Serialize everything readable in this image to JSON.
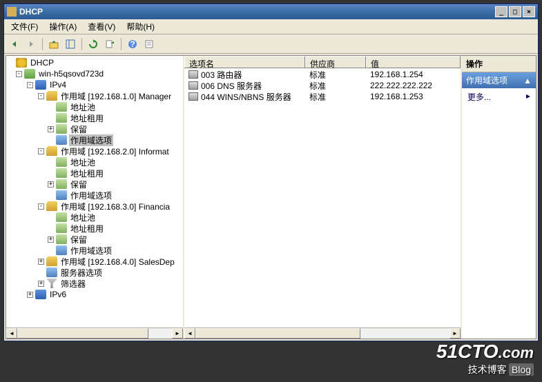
{
  "window": {
    "title": "DHCP"
  },
  "titlebar_buttons": {
    "min": "_",
    "max": "□",
    "close": "×"
  },
  "menu": {
    "file": "文件(F)",
    "action": "操作(A)",
    "view": "查看(V)",
    "help": "帮助(H)"
  },
  "tree": {
    "root": "DHCP",
    "server": "win-h5qsovd723d",
    "ipv4": "IPv4",
    "ipv6": "IPv6",
    "scope1": {
      "label": "作用域 [192.168.1.0] Manager",
      "pool": "地址池",
      "lease": "地址租用",
      "reserve": "保留",
      "options": "作用域选项"
    },
    "scope2": {
      "label": "作用域 [192.168.2.0] Informat",
      "pool": "地址池",
      "lease": "地址租用",
      "reserve": "保留",
      "options": "作用域选项"
    },
    "scope3": {
      "label": "作用域 [192.168.3.0] Financia",
      "pool": "地址池",
      "lease": "地址租用",
      "reserve": "保留",
      "options": "作用域选项"
    },
    "scope4": {
      "label": "作用域 [192.168.4.0] SalesDep"
    },
    "server_options": "服务器选项",
    "filter": "筛选器"
  },
  "list": {
    "columns": {
      "name": "选项名",
      "vendor": "供应商",
      "value": "值"
    },
    "rows": [
      {
        "name": "003 路由器",
        "vendor": "标准",
        "value": "192.168.1.254"
      },
      {
        "name": "006 DNS 服务器",
        "vendor": "标准",
        "value": "222.222.222.222"
      },
      {
        "name": "044 WINS/NBNS 服务器",
        "vendor": "标准",
        "value": "192.168.1.253"
      }
    ]
  },
  "actions": {
    "header": "操作",
    "subheader": "作用域选项",
    "more": "更多..."
  },
  "watermark": {
    "main": "51CTO",
    "suffix": ".com",
    "sub": "技术博客",
    "tag": "Blog"
  }
}
